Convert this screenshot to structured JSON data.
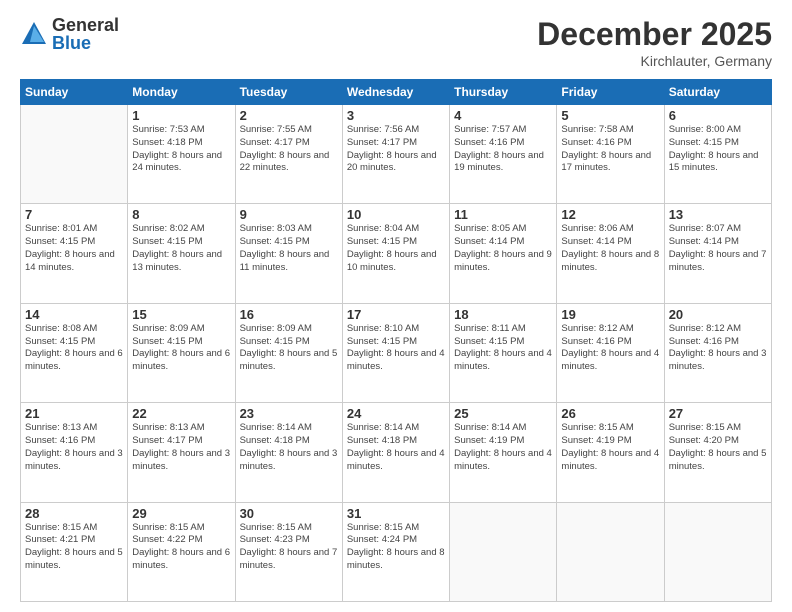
{
  "header": {
    "logo_general": "General",
    "logo_blue": "Blue",
    "month_title": "December 2025",
    "subtitle": "Kirchlauter, Germany"
  },
  "calendar": {
    "days_of_week": [
      "Sunday",
      "Monday",
      "Tuesday",
      "Wednesday",
      "Thursday",
      "Friday",
      "Saturday"
    ],
    "weeks": [
      [
        {
          "day": "",
          "info": ""
        },
        {
          "day": "1",
          "info": "Sunrise: 7:53 AM\nSunset: 4:18 PM\nDaylight: 8 hours\nand 24 minutes."
        },
        {
          "day": "2",
          "info": "Sunrise: 7:55 AM\nSunset: 4:17 PM\nDaylight: 8 hours\nand 22 minutes."
        },
        {
          "day": "3",
          "info": "Sunrise: 7:56 AM\nSunset: 4:17 PM\nDaylight: 8 hours\nand 20 minutes."
        },
        {
          "day": "4",
          "info": "Sunrise: 7:57 AM\nSunset: 4:16 PM\nDaylight: 8 hours\nand 19 minutes."
        },
        {
          "day": "5",
          "info": "Sunrise: 7:58 AM\nSunset: 4:16 PM\nDaylight: 8 hours\nand 17 minutes."
        },
        {
          "day": "6",
          "info": "Sunrise: 8:00 AM\nSunset: 4:15 PM\nDaylight: 8 hours\nand 15 minutes."
        }
      ],
      [
        {
          "day": "7",
          "info": "Sunrise: 8:01 AM\nSunset: 4:15 PM\nDaylight: 8 hours\nand 14 minutes."
        },
        {
          "day": "8",
          "info": "Sunrise: 8:02 AM\nSunset: 4:15 PM\nDaylight: 8 hours\nand 13 minutes."
        },
        {
          "day": "9",
          "info": "Sunrise: 8:03 AM\nSunset: 4:15 PM\nDaylight: 8 hours\nand 11 minutes."
        },
        {
          "day": "10",
          "info": "Sunrise: 8:04 AM\nSunset: 4:15 PM\nDaylight: 8 hours\nand 10 minutes."
        },
        {
          "day": "11",
          "info": "Sunrise: 8:05 AM\nSunset: 4:14 PM\nDaylight: 8 hours\nand 9 minutes."
        },
        {
          "day": "12",
          "info": "Sunrise: 8:06 AM\nSunset: 4:14 PM\nDaylight: 8 hours\nand 8 minutes."
        },
        {
          "day": "13",
          "info": "Sunrise: 8:07 AM\nSunset: 4:14 PM\nDaylight: 8 hours\nand 7 minutes."
        }
      ],
      [
        {
          "day": "14",
          "info": "Sunrise: 8:08 AM\nSunset: 4:15 PM\nDaylight: 8 hours\nand 6 minutes."
        },
        {
          "day": "15",
          "info": "Sunrise: 8:09 AM\nSunset: 4:15 PM\nDaylight: 8 hours\nand 6 minutes."
        },
        {
          "day": "16",
          "info": "Sunrise: 8:09 AM\nSunset: 4:15 PM\nDaylight: 8 hours\nand 5 minutes."
        },
        {
          "day": "17",
          "info": "Sunrise: 8:10 AM\nSunset: 4:15 PM\nDaylight: 8 hours\nand 4 minutes."
        },
        {
          "day": "18",
          "info": "Sunrise: 8:11 AM\nSunset: 4:15 PM\nDaylight: 8 hours\nand 4 minutes."
        },
        {
          "day": "19",
          "info": "Sunrise: 8:12 AM\nSunset: 4:16 PM\nDaylight: 8 hours\nand 4 minutes."
        },
        {
          "day": "20",
          "info": "Sunrise: 8:12 AM\nSunset: 4:16 PM\nDaylight: 8 hours\nand 3 minutes."
        }
      ],
      [
        {
          "day": "21",
          "info": "Sunrise: 8:13 AM\nSunset: 4:16 PM\nDaylight: 8 hours\nand 3 minutes."
        },
        {
          "day": "22",
          "info": "Sunrise: 8:13 AM\nSunset: 4:17 PM\nDaylight: 8 hours\nand 3 minutes."
        },
        {
          "day": "23",
          "info": "Sunrise: 8:14 AM\nSunset: 4:18 PM\nDaylight: 8 hours\nand 3 minutes."
        },
        {
          "day": "24",
          "info": "Sunrise: 8:14 AM\nSunset: 4:18 PM\nDaylight: 8 hours\nand 4 minutes."
        },
        {
          "day": "25",
          "info": "Sunrise: 8:14 AM\nSunset: 4:19 PM\nDaylight: 8 hours\nand 4 minutes."
        },
        {
          "day": "26",
          "info": "Sunrise: 8:15 AM\nSunset: 4:19 PM\nDaylight: 8 hours\nand 4 minutes."
        },
        {
          "day": "27",
          "info": "Sunrise: 8:15 AM\nSunset: 4:20 PM\nDaylight: 8 hours\nand 5 minutes."
        }
      ],
      [
        {
          "day": "28",
          "info": "Sunrise: 8:15 AM\nSunset: 4:21 PM\nDaylight: 8 hours\nand 5 minutes."
        },
        {
          "day": "29",
          "info": "Sunrise: 8:15 AM\nSunset: 4:22 PM\nDaylight: 8 hours\nand 6 minutes."
        },
        {
          "day": "30",
          "info": "Sunrise: 8:15 AM\nSunset: 4:23 PM\nDaylight: 8 hours\nand 7 minutes."
        },
        {
          "day": "31",
          "info": "Sunrise: 8:15 AM\nSunset: 4:24 PM\nDaylight: 8 hours\nand 8 minutes."
        },
        {
          "day": "",
          "info": ""
        },
        {
          "day": "",
          "info": ""
        },
        {
          "day": "",
          "info": ""
        }
      ]
    ]
  }
}
